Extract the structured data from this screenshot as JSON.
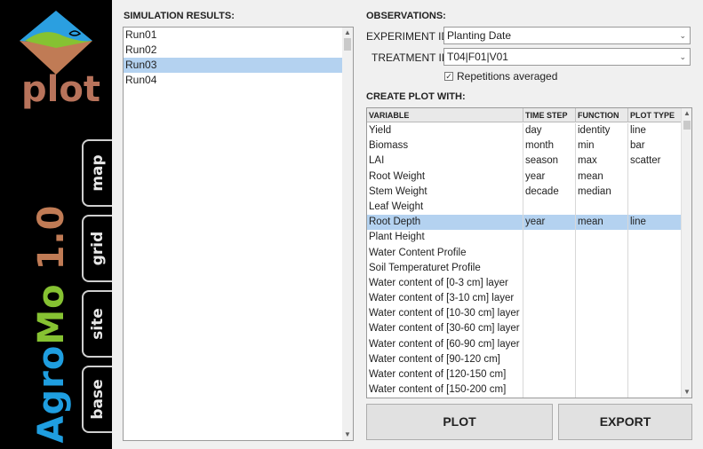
{
  "sidebar": {
    "logo_text": "plot",
    "brand_part1": "Agro",
    "brand_part2": "Mo",
    "brand_version": " 1.0",
    "tabs": [
      "map",
      "grid",
      "site",
      "base"
    ],
    "colors": {
      "blue": "#1f9ee0",
      "green": "#86c232",
      "brown": "#c07b55"
    }
  },
  "simulation": {
    "title": "SIMULATION RESULTS:",
    "runs": [
      "Run01",
      "Run02",
      "Run03",
      "Run04"
    ],
    "selected_index": 2
  },
  "observations": {
    "title": "OBSERVATIONS:",
    "experiment_label": "EXPERIMENT ID:",
    "experiment_value": "Planting Date",
    "treatment_label": "TREATMENT ID:",
    "treatment_value": "T04|F01|V01",
    "repetitions_label": "Repetitions averaged",
    "repetitions_checked": true
  },
  "create_plot": {
    "title": "CREATE PLOT WITH:",
    "columns": [
      "VARIABLE",
      "TIME STEP",
      "FUNCTION",
      "PLOT TYPE"
    ],
    "rows": [
      [
        "Yield",
        "day",
        "identity",
        "line"
      ],
      [
        "Biomass",
        "month",
        "min",
        "bar"
      ],
      [
        "LAI",
        "season",
        "max",
        "scatter"
      ],
      [
        "Root Weight",
        "year",
        "mean",
        ""
      ],
      [
        "Stem Weight",
        "decade",
        "median",
        ""
      ],
      [
        "Leaf Weight",
        "",
        "",
        ""
      ],
      [
        "Root Depth",
        "year",
        "mean",
        "line"
      ],
      [
        "Plant Height",
        "",
        "",
        ""
      ],
      [
        "Water Content Profile",
        "",
        "",
        ""
      ],
      [
        "Soil Temperaturet Profile",
        "",
        "",
        ""
      ],
      [
        "Water content of [0-3 cm] layer",
        "",
        "",
        ""
      ],
      [
        "Water content of [3-10 cm] layer",
        "",
        "",
        ""
      ],
      [
        "Water content of [10-30 cm] layer",
        "",
        "",
        ""
      ],
      [
        "Water content of [30-60 cm] layer",
        "",
        "",
        ""
      ],
      [
        "Water content of [60-90 cm] layer",
        "",
        "",
        ""
      ],
      [
        "Water content of [90-120 cm]",
        "",
        "",
        ""
      ],
      [
        "Water content of [120-150 cm]",
        "",
        "",
        ""
      ],
      [
        "Water content of [150-200 cm]",
        "",
        "",
        ""
      ]
    ],
    "selected_index": 6
  },
  "buttons": {
    "plot": "PLOT",
    "export": "EXPORT"
  }
}
